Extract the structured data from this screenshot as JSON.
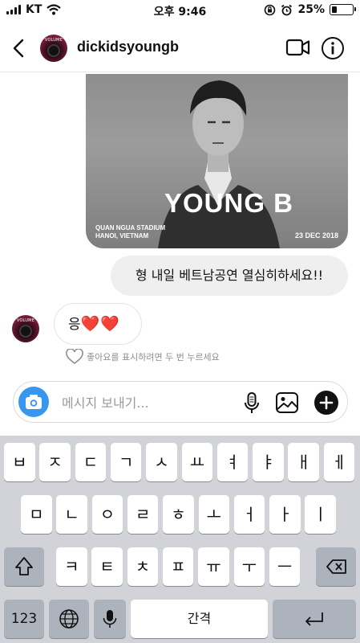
{
  "status_bar": {
    "carrier": "KT",
    "time": "오후 9:46",
    "battery": "25%",
    "battery_level": 0.25
  },
  "header": {
    "username": "dickidsyoungb",
    "avatar_text": "VOLUME"
  },
  "messages": {
    "image": {
      "title": "YOUNG B",
      "venue_line1": "QUAN NGUA STADIUM",
      "venue_line2": "HANOI, VIETNAM",
      "date": "23 DEC 2018"
    },
    "sent_text": "형 내일 베트남공연 열심히하세요!!",
    "received_text": "응",
    "received_hearts": "❤️❤️",
    "like_hint": "좋아요를 표시하려면 두 번 누르세요"
  },
  "composer": {
    "placeholder": "메시지 보내기..."
  },
  "keyboard": {
    "row1": [
      "ㅂ",
      "ㅈ",
      "ㄷ",
      "ㄱ",
      "ㅅ",
      "ㅛ",
      "ㅕ",
      "ㅑ",
      "ㅐ",
      "ㅔ"
    ],
    "row2": [
      "ㅁ",
      "ㄴ",
      "ㅇ",
      "ㄹ",
      "ㅎ",
      "ㅗ",
      "ㅓ",
      "ㅏ",
      "ㅣ"
    ],
    "row3": [
      "ㅋ",
      "ㅌ",
      "ㅊ",
      "ㅍ",
      "ㅠ",
      "ㅜ",
      "ㅡ"
    ],
    "numbers_label": "123",
    "space_label": "간격"
  },
  "icons": [
    "signal-icon",
    "wifi-icon",
    "orientation-lock-icon",
    "alarm-icon",
    "battery-icon",
    "back-chevron-icon",
    "video-call-icon",
    "info-icon",
    "heart-outline-icon",
    "camera-icon",
    "microphone-icon",
    "gallery-icon",
    "plus-icon",
    "shift-icon",
    "backspace-icon",
    "globe-icon",
    "return-icon"
  ]
}
